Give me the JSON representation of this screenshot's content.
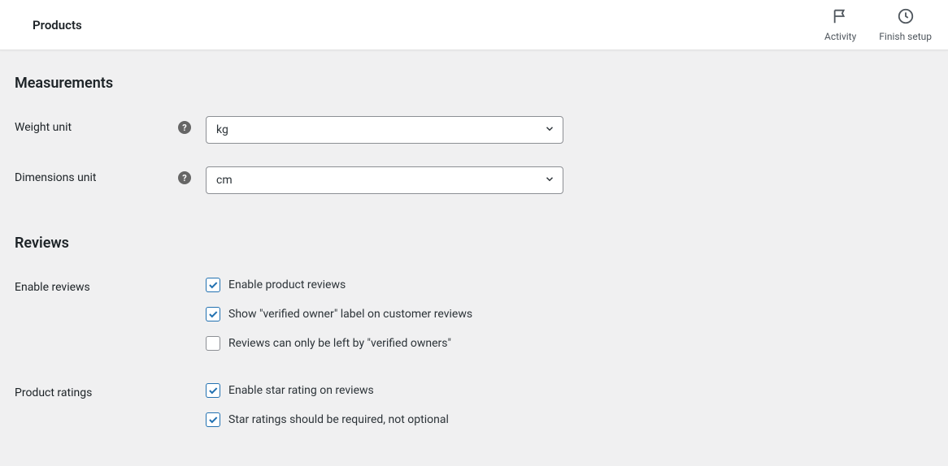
{
  "header": {
    "title": "Products",
    "actions": {
      "activity": "Activity",
      "finish_setup": "Finish setup"
    }
  },
  "sections": {
    "measurements": {
      "heading": "Measurements",
      "weight_unit": {
        "label": "Weight unit",
        "value": "kg"
      },
      "dimensions_unit": {
        "label": "Dimensions unit",
        "value": "cm"
      }
    },
    "reviews": {
      "heading": "Reviews",
      "enable_reviews": {
        "label": "Enable reviews",
        "opt1": {
          "label": "Enable product reviews",
          "checked": true
        },
        "opt2": {
          "label": "Show \"verified owner\" label on customer reviews",
          "checked": true
        },
        "opt3": {
          "label": "Reviews can only be left by \"verified owners\"",
          "checked": false
        }
      },
      "product_ratings": {
        "label": "Product ratings",
        "opt1": {
          "label": "Enable star rating on reviews",
          "checked": true
        },
        "opt2": {
          "label": "Star ratings should be required, not optional",
          "checked": true
        }
      }
    }
  }
}
